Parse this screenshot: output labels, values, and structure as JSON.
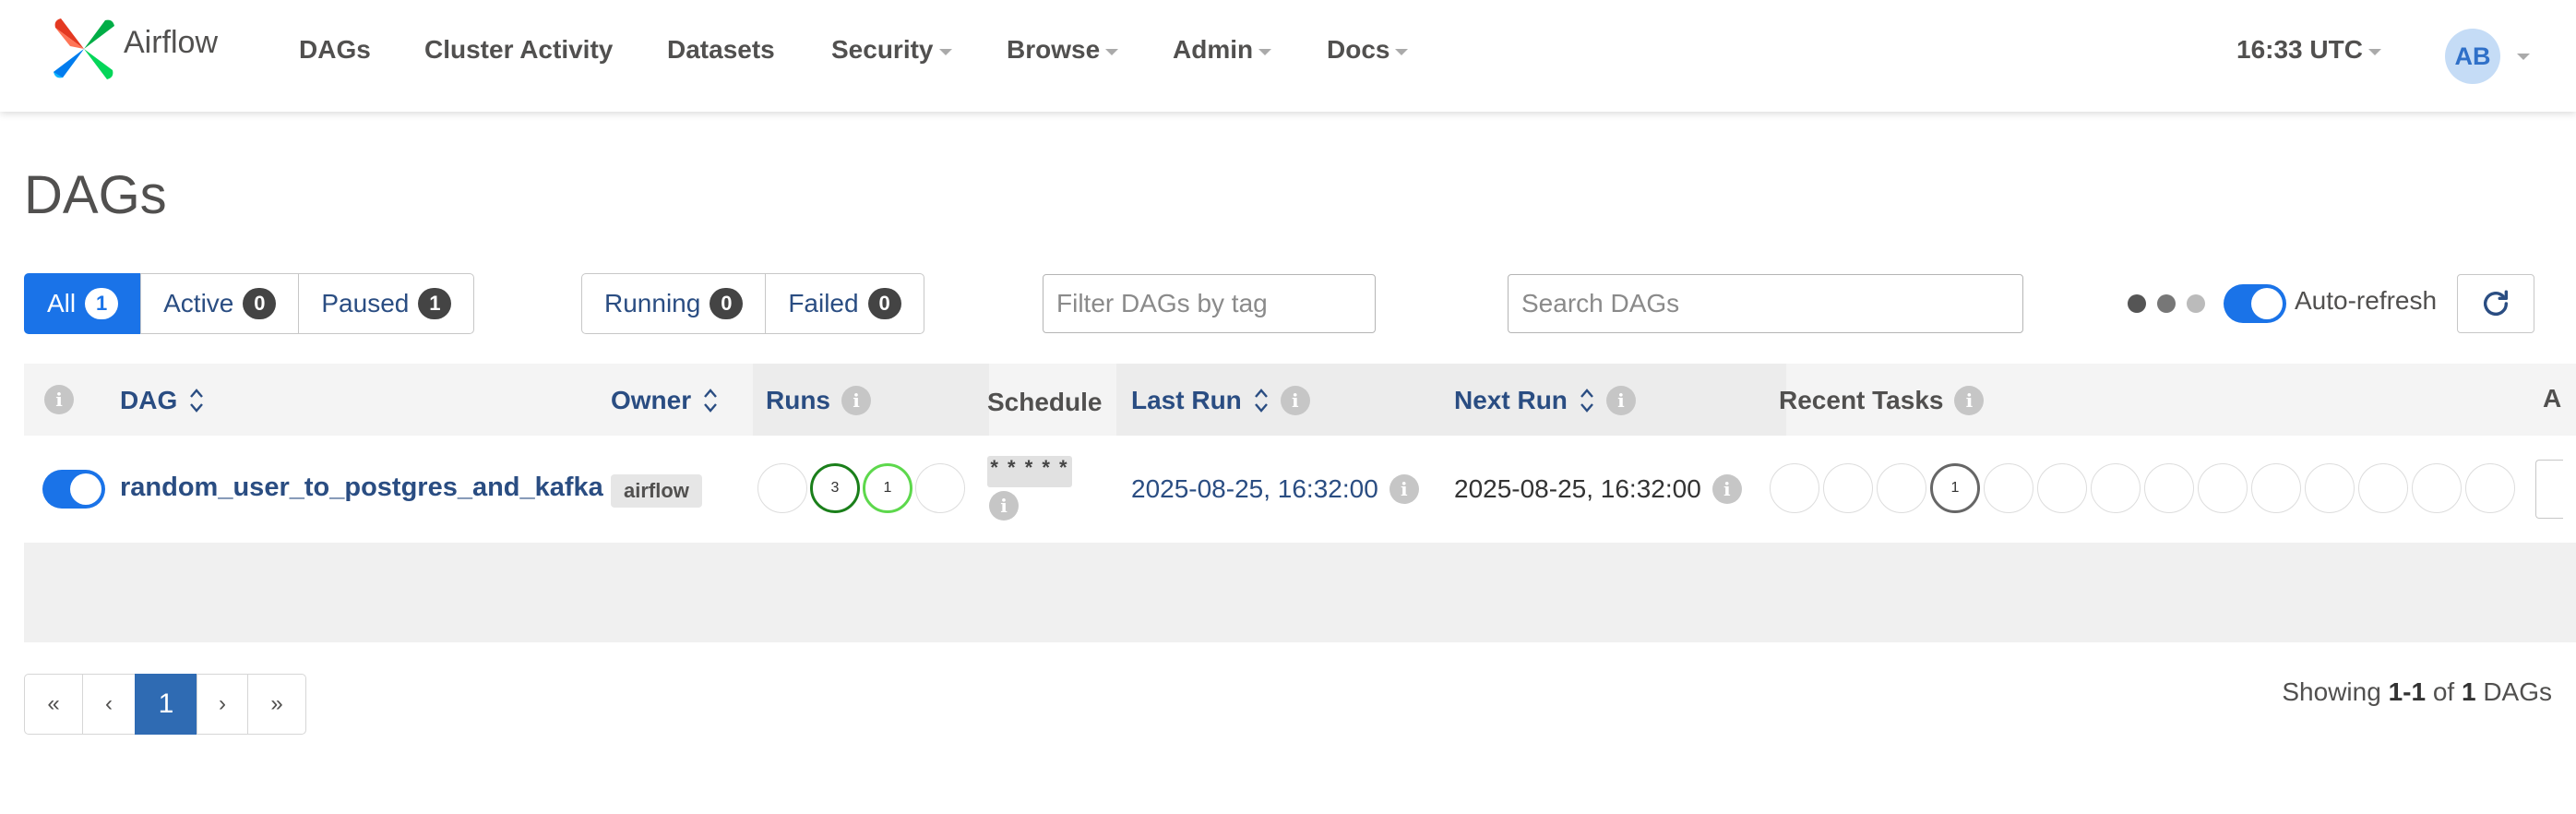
{
  "brand": {
    "name": "Airflow",
    "logo_icon": "airflow-pinwheel-icon"
  },
  "nav": {
    "items": [
      {
        "label": "DAGs",
        "dropdown": false
      },
      {
        "label": "Cluster Activity",
        "dropdown": false
      },
      {
        "label": "Datasets",
        "dropdown": false
      },
      {
        "label": "Security",
        "dropdown": true
      },
      {
        "label": "Browse",
        "dropdown": true
      },
      {
        "label": "Admin",
        "dropdown": true
      },
      {
        "label": "Docs",
        "dropdown": true
      }
    ],
    "clock": "16:33 UTC",
    "avatar_initials": "AB"
  },
  "page": {
    "title": "DAGs"
  },
  "filters": {
    "status": [
      {
        "label": "All",
        "count": "1",
        "active": true
      },
      {
        "label": "Active",
        "count": "0",
        "active": false
      },
      {
        "label": "Paused",
        "count": "1",
        "active": false
      }
    ],
    "runs": [
      {
        "label": "Running",
        "count": "0"
      },
      {
        "label": "Failed",
        "count": "0"
      }
    ],
    "tag_placeholder": "Filter DAGs by tag",
    "search_placeholder": "Search DAGs",
    "auto_refresh_label": "Auto-refresh",
    "auto_refresh_on": true
  },
  "table": {
    "columns": {
      "dag": "DAG",
      "owner": "Owner",
      "runs": "Runs",
      "schedule": "Schedule",
      "last_run": "Last Run",
      "next_run": "Next Run",
      "recent_tasks": "Recent Tasks"
    },
    "rows": [
      {
        "active": true,
        "dag_id": "random_user_to_postgres_and_kafka",
        "owner": "airflow",
        "runs": [
          {
            "count": "",
            "state": "none"
          },
          {
            "count": "3",
            "state": "success"
          },
          {
            "count": "1",
            "state": "running"
          },
          {
            "count": "",
            "state": "none"
          }
        ],
        "schedule": "* * * * *",
        "last_run": "2025-08-25, 16:32:00",
        "next_run": "2025-08-25, 16:32:00",
        "recent_tasks": [
          "",
          "",
          "",
          "1",
          "",
          "",
          "",
          "",
          "",
          "",
          "",
          "",
          "",
          ""
        ]
      }
    ]
  },
  "pagination": {
    "first": "«",
    "prev": "‹",
    "current": "1",
    "next": "›",
    "last": "»",
    "showing_prefix": "Showing",
    "range": "1-1",
    "of": "of",
    "total": "1",
    "suffix": "DAGs"
  },
  "colors": {
    "primary": "#1a73e8",
    "link": "#2a4d82",
    "run_success": "#1a7f1a",
    "run_running": "#5dd84c",
    "task_state": "#666666"
  }
}
